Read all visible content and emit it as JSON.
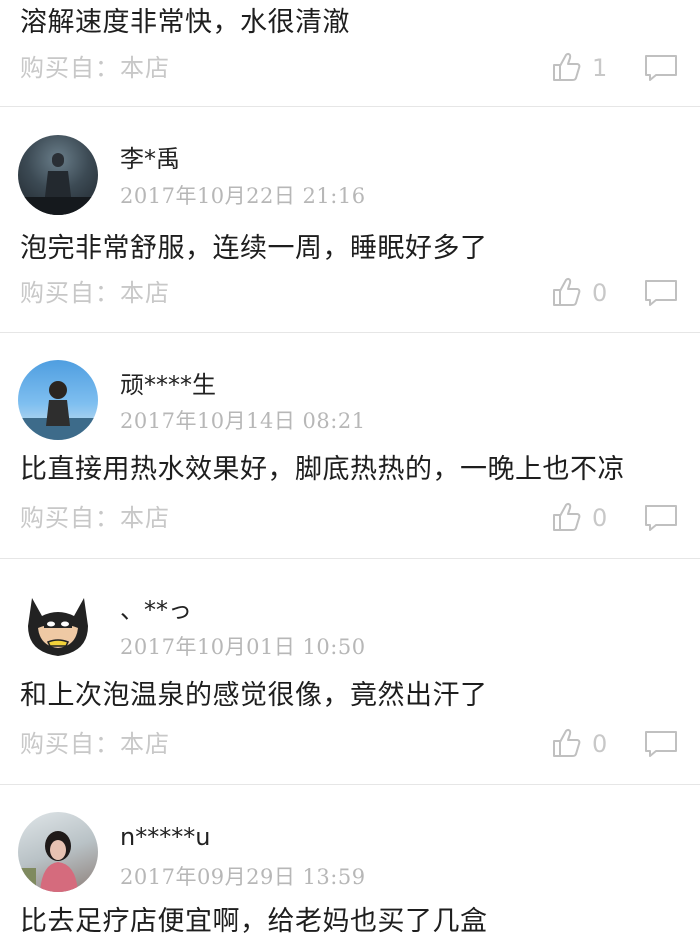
{
  "top_review": {
    "text": "溶解速度非常快，水很清澈",
    "source": "购买自：本店",
    "likes": "1"
  },
  "reviews": [
    {
      "user": "李*禹",
      "date": "2017年10月22日  21:16",
      "text": "泡完非常舒服，连续一周，睡眠好多了",
      "source": "购买自：本店",
      "likes": "0"
    },
    {
      "user": "顽****生",
      "date": "2017年10月14日  08:21",
      "text": "比直接用热水效果好，脚底热热的，一晚上也不凉",
      "source": "购买自：本店",
      "likes": "0"
    },
    {
      "user": "、**っ",
      "date": "2017年10月01日  10:50",
      "text": "和上次泡温泉的感觉很像，竟然出汗了",
      "source": "购买自：本店",
      "likes": "0"
    },
    {
      "user": "n*****u",
      "date": "2017年09月29日  13:59",
      "text": "比去足疗店便宜啊，给老妈也买了几盒"
    }
  ],
  "icons": {
    "like": "thumbs-up-icon",
    "comment": "comment-bubble-icon"
  },
  "colors": {
    "muted": "#c8c8c8",
    "divider": "#e6e6e6"
  }
}
